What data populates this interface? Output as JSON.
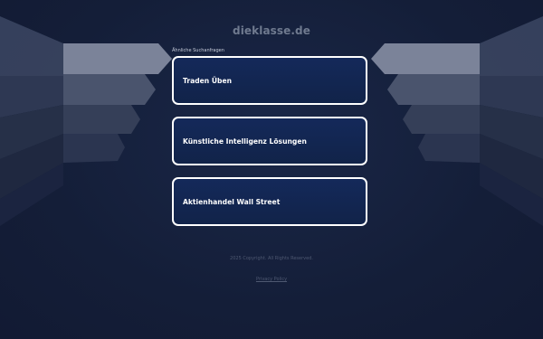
{
  "site": {
    "title": "dieklasse.de"
  },
  "related": {
    "label": "Ähnliche Suchanfragen",
    "items": [
      {
        "label": "Traden Üben"
      },
      {
        "label": "Künstliche Intelligenz Lösungen"
      },
      {
        "label": "Aktienhandel Wall Street"
      }
    ]
  },
  "footer": {
    "copyright": "2025 Copyright.  All Rights Reserved.",
    "privacy_link": "Privacy Policy"
  },
  "colors": {
    "background": "#141e38",
    "card_background": "#13285a",
    "card_border": "#ffffff",
    "title_text": "#6f7a8f"
  }
}
